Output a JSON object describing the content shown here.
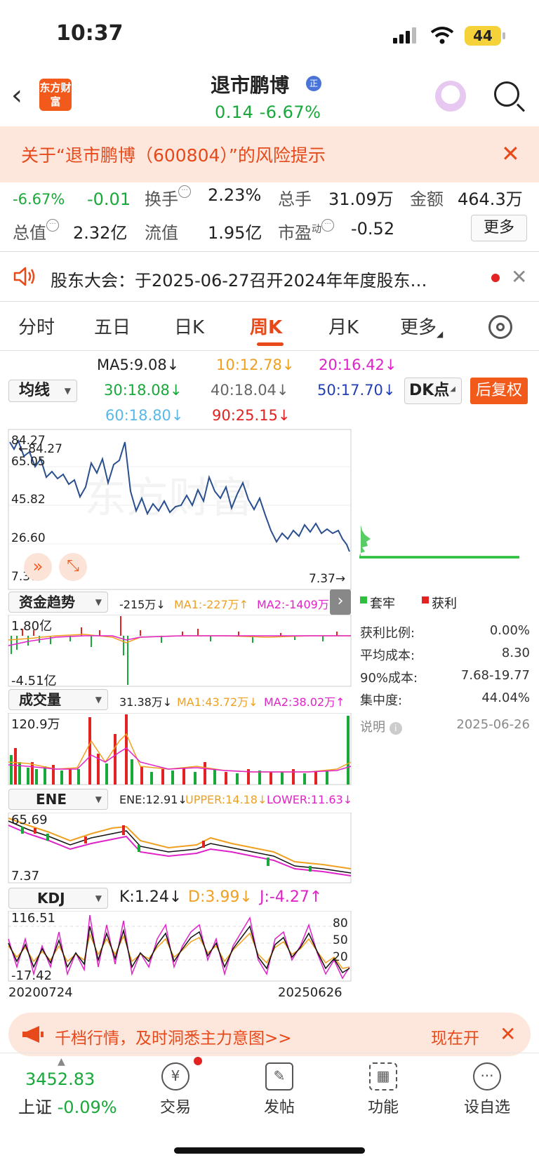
{
  "status_bar": {
    "time": "10:37",
    "battery": "44"
  },
  "header": {
    "logo": "东方财富",
    "stock_name": "退市鹏博",
    "badge": "正",
    "change": "0.14  -6.67%"
  },
  "risk_banner": {
    "text": "关于“退市鹏博（600804）”的风险提示"
  },
  "quote": {
    "pct": "-6.67%",
    "chg": "-0.01",
    "turnover_label": "换手",
    "turnover": "2.23%",
    "volume_label": "总手",
    "volume": "31.09万",
    "amount_label": "金额",
    "amount": "464.3万",
    "mktcap_label": "总值",
    "mktcap": "2.32亿",
    "float_label": "流值",
    "float": "1.95亿",
    "pe_label": "市盈",
    "pe_sup": "动",
    "pe": "-0.52",
    "more": "更多"
  },
  "notice": {
    "text": "股东大会：于2025-06-27召开2024年年度股东…"
  },
  "tabs": [
    "分时",
    "五日",
    "日K",
    "周K",
    "月K",
    "更多"
  ],
  "active_tab": "周K",
  "ma": {
    "select": "均线",
    "ma5": "MA5:9.08↓",
    "ma10": "10:12.78↓",
    "ma20": "20:16.42↓",
    "ma30": "30:18.08↓",
    "ma40": "40:18.04↓",
    "ma50": "50:17.70↓",
    "ma60": "60:18.80↓",
    "ma90": "90:25.15↓",
    "dk": "DK点",
    "restore": "后复权"
  },
  "colors": {
    "up": "#e32222",
    "down": "#19a83a",
    "accent": "#f25a1b",
    "price_line": "#2a4f8f"
  },
  "main_chart": {
    "y_labels": [
      "84.27",
      "65.05",
      "45.82",
      "26.60",
      "7.37"
    ],
    "high_mark": "←84.27",
    "low_mark": "7.37→",
    "watermark": "东方财富"
  },
  "fund_panel": {
    "select": "资金趋势",
    "val": "-215万↓",
    "ma1": "MA1:-227万↑",
    "ma2": "MA2:-1409万↑",
    "top": "1.80亿",
    "bottom": "-4.51亿"
  },
  "vol_panel": {
    "select": "成交量",
    "val": "31.38万↓",
    "ma1": "MA1:43.72万↓",
    "ma2": "MA2:38.02万↑",
    "top": "120.9万"
  },
  "ene_panel": {
    "select": "ENE",
    "val": "ENE:12.91↓",
    "upper": "UPPER:14.18↓",
    "lower": "LOWER:11.63↓",
    "top": "65.69",
    "bottom": "7.37"
  },
  "kdj_panel": {
    "select": "KDJ",
    "k": "K:1.24↓",
    "d": "D:3.99↓",
    "j": "J:-4.27↑",
    "top": "116.51",
    "bottom": "-17.42",
    "levels": [
      "80",
      "50",
      "20"
    ]
  },
  "dates": {
    "start": "20200724",
    "end": "20250626"
  },
  "chips": {
    "legend_trapped": "套牢",
    "legend_profit": "获利",
    "rows": [
      {
        "label": "获利比例:",
        "value": "0.00%"
      },
      {
        "label": "平均成本:",
        "value": "8.30"
      },
      {
        "label": "90%成本:",
        "value": "7.68-19.77"
      },
      {
        "label": "集中度:",
        "value": "44.04%"
      },
      {
        "label": "说明",
        "value": "2025-06-26"
      }
    ]
  },
  "ad": {
    "text": "千档行情，及时洞悉主力意图>>",
    "action": "现在开"
  },
  "bottom_nav": {
    "index_value": "3452.83",
    "index_name": "上证",
    "index_pct": "-0.09%",
    "trade": "交易",
    "post": "发帖",
    "func": "功能",
    "watch": "设自选"
  }
}
